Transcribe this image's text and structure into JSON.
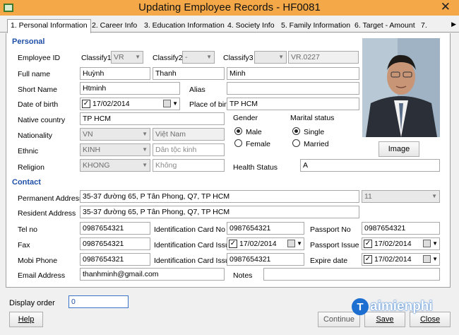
{
  "window": {
    "title": "Updating Employee Records - HF0081"
  },
  "tabs": [
    {
      "label": "1. Personal Information"
    },
    {
      "label": "2. Career Info"
    },
    {
      "label": "3. Education Information"
    },
    {
      "label": "4. Society Info"
    },
    {
      "label": "5. Family Information"
    },
    {
      "label": "6. Target - Amount"
    },
    {
      "label": "7."
    }
  ],
  "personal": {
    "heading": "Personal",
    "employee_id_label": "Employee ID",
    "classify1_label": "Classify1",
    "classify1_value": "VR",
    "classify2_label": "Classify2",
    "classify2_value": "-",
    "classify3_label": "Classify3",
    "classify3_value": "",
    "employee_id_value": "VR.0227",
    "full_name_label": "Full name",
    "last_name": "Huỳnh",
    "middle_name": "Thanh",
    "first_name": "Minh",
    "short_name_label": "Short Name",
    "short_name": "Htminh",
    "alias_label": "Alias",
    "alias": "",
    "dob_label": "Date of birth",
    "dob": "17/02/2014",
    "pob_label": "Place of birth",
    "pob": "TP HCM",
    "native_label": "Native country",
    "native": "TP HCM",
    "gender_label": "Gender",
    "gender_male": "Male",
    "gender_female": "Female",
    "gender_selected": "Male",
    "marital_label": "Marital status",
    "marital_single": "Single",
    "marital_married": "Married",
    "marital_selected": "Single",
    "nationality_label": "Nationality",
    "nationality_code": "VN",
    "nationality_name": "Việt Nam",
    "ethnic_label": "Ethnic",
    "ethnic_code": "KINH",
    "ethnic_placeholder": "Dân tộc kinh",
    "religion_label": "Religion",
    "religion_code": "KHONG",
    "religion_placeholder": "Không",
    "health_label": "Health Status",
    "health": "A",
    "image_button": "Image"
  },
  "contact": {
    "heading": "Contact",
    "permanent_label": "Permanent Address",
    "permanent": "35-37 đường 65, P Tân Phong, Q7, TP HCM",
    "permanent_code": "11",
    "resident_label": "Resident Address",
    "resident": "35-37 đường 65, P Tân Phong, Q7, TP HCM",
    "tel_label": "Tel no",
    "tel": "0987654321",
    "idcard_label": "Identification Card No",
    "idcard": "0987654321",
    "passport_label": "Passport No",
    "passport": "0987654321",
    "fax_label": "Fax",
    "fax": "0987654321",
    "idcard_issue_label": "Identification Card Issue D",
    "idcard_issue": "17/02/2014",
    "passport_issue_label": "Passport Issue Da",
    "passport_issue": "17/02/2014",
    "mobi_label": "Mobi Phone",
    "mobi": "0987654321",
    "idcard_place_label": "Identification Card Issue Place",
    "idcard_place": "0987654321",
    "expire_label": "Expire date",
    "expire": "17/02/2014",
    "email_label": "Email Address",
    "email": "thanhminh@gmail.com",
    "notes_label": "Notes",
    "notes": ""
  },
  "footer": {
    "display_order_label": "Display order",
    "display_order": "0",
    "help": "Help",
    "continue": "Continue",
    "save": "Save",
    "close": "Close"
  },
  "watermark": {
    "text": "aimienphi"
  }
}
